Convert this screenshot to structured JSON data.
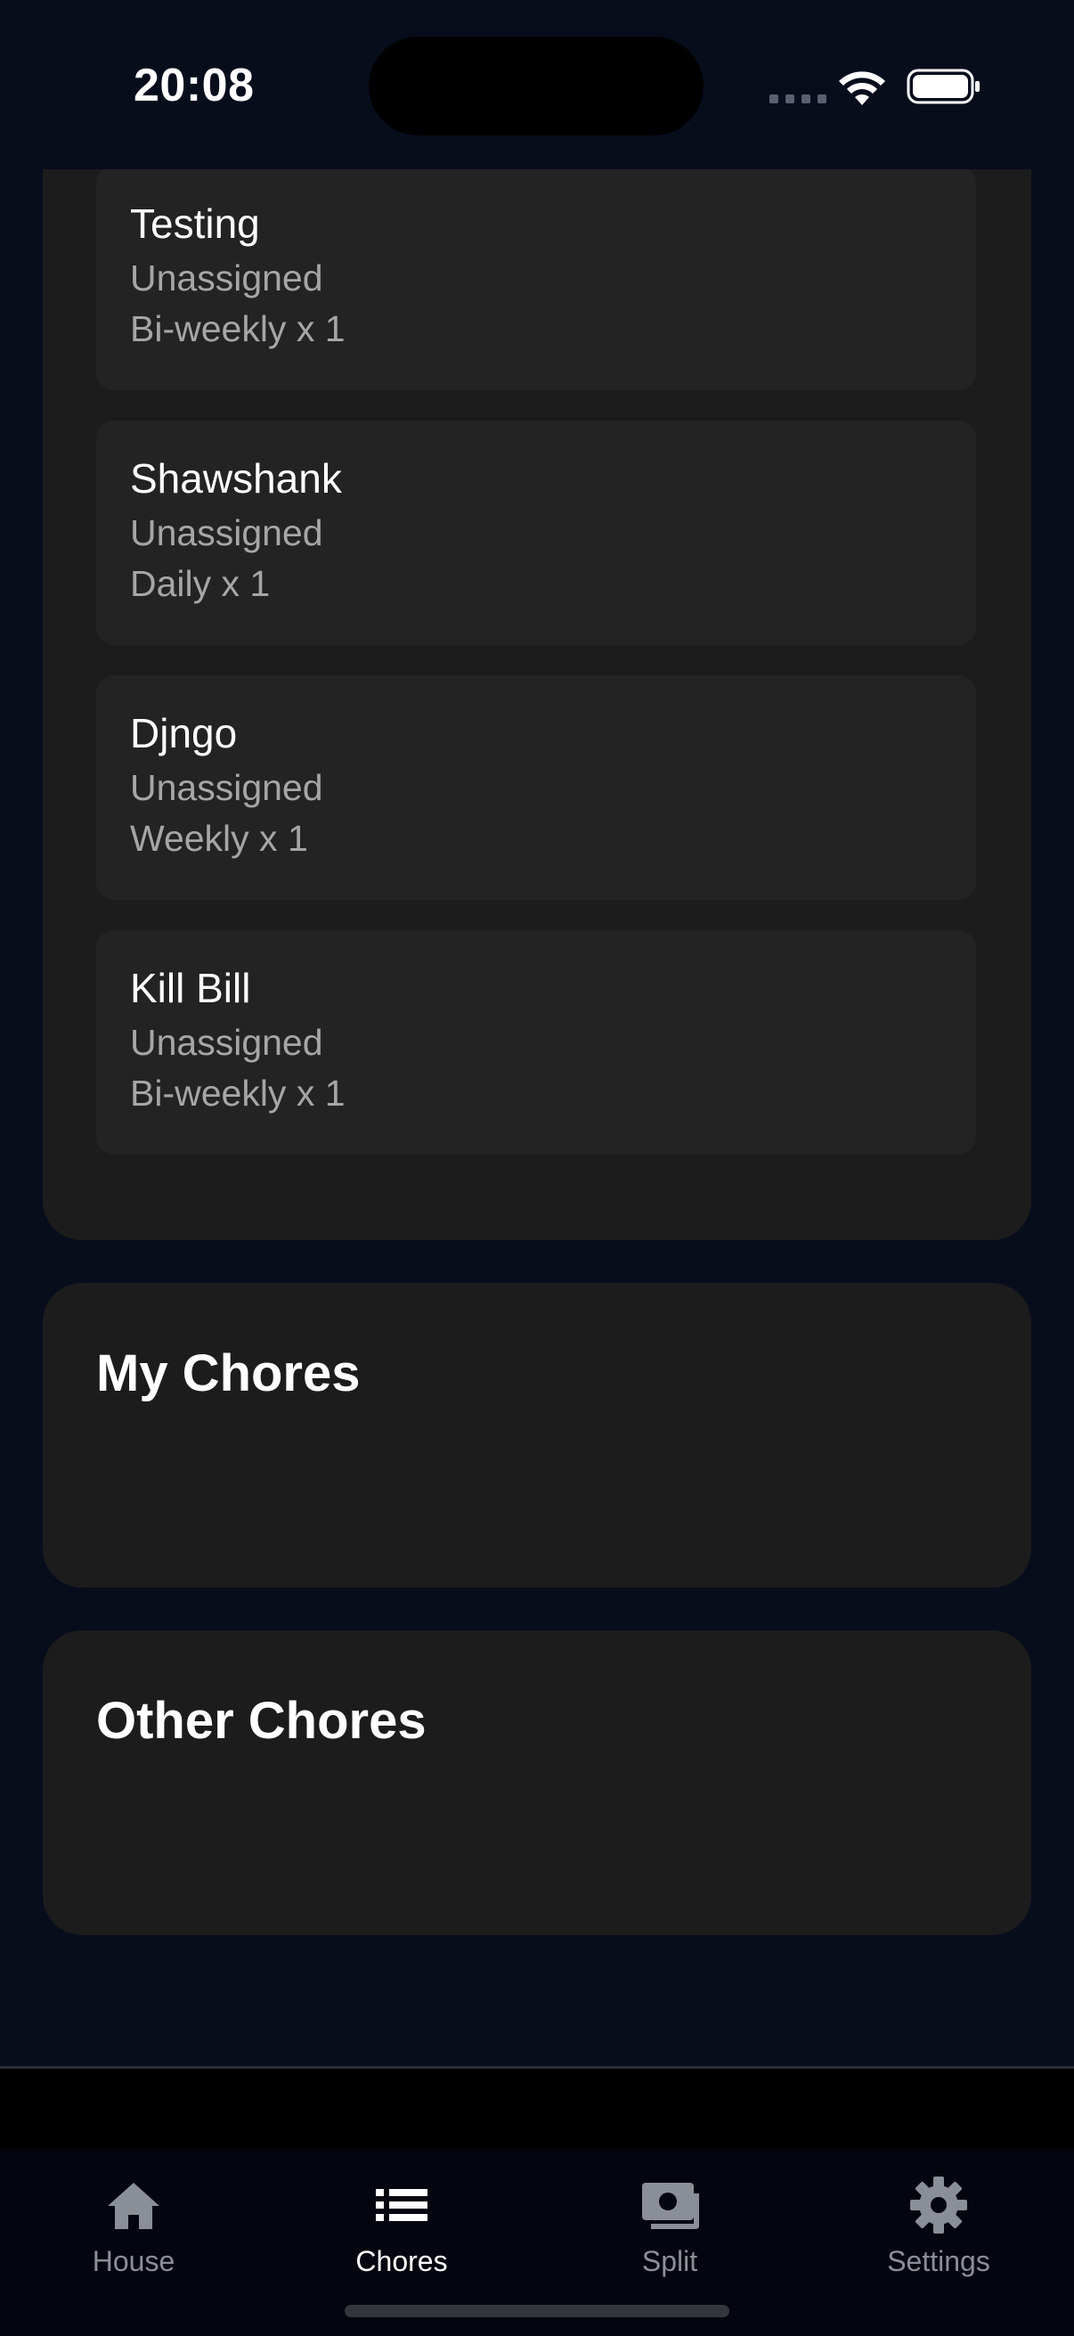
{
  "status_bar": {
    "time": "20:08"
  },
  "unassigned_chores": [
    {
      "name": "Testing",
      "assignee": "Unassigned",
      "frequency": "Bi-weekly x 1"
    },
    {
      "name": "Shawshank",
      "assignee": "Unassigned",
      "frequency": "Daily x 1"
    },
    {
      "name": "Djngo",
      "assignee": "Unassigned",
      "frequency": "Weekly x 1"
    },
    {
      "name": "Kill Bill",
      "assignee": "Unassigned",
      "frequency": "Bi-weekly x 1"
    }
  ],
  "sections": {
    "my_chores": {
      "title": "My Chores"
    },
    "other_chores": {
      "title": "Other Chores"
    }
  },
  "tab_bar": {
    "tabs": [
      {
        "label": "House",
        "icon": "house-icon",
        "active": false
      },
      {
        "label": "Chores",
        "icon": "list-icon",
        "active": true
      },
      {
        "label": "Split",
        "icon": "money-icon",
        "active": false
      },
      {
        "label": "Settings",
        "icon": "gear-icon",
        "active": false
      }
    ]
  },
  "colors": {
    "background": "#080d1c",
    "card": "#1c1c1c",
    "chore_item": "#232323",
    "secondary_text": "#a6a6a6",
    "tab_inactive": "#8a8e96",
    "tab_active": "#ffffff"
  }
}
